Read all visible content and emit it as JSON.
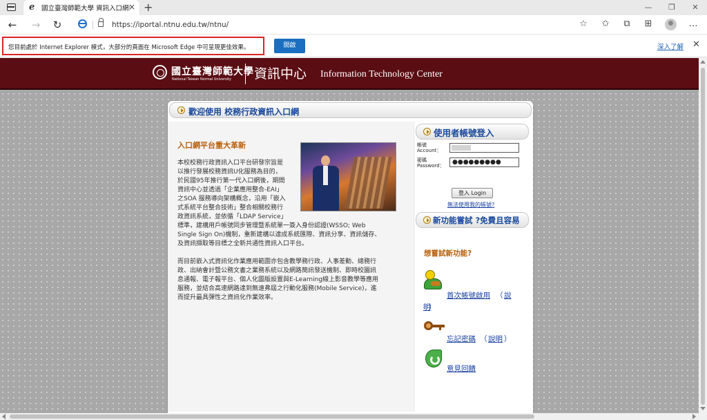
{
  "browser": {
    "tab_title": "國立臺灣師範大學 資訊入口網站",
    "tab_close": "×",
    "new_tab": "+",
    "window_buttons": [
      "—",
      "❐",
      "✕"
    ],
    "url": "https://iportal.ntnu.edu.tw/ntnu/",
    "nav": {
      "back": "←",
      "forward": "→",
      "reload": "↻"
    },
    "toolbar_icons": [
      "favorites-add-icon",
      "favorites-icon",
      "collections-icon",
      "extensions-icon",
      "profile-icon",
      "more-icon"
    ],
    "toolbar_glyphs": {
      "fav_add": "☆",
      "favorites": "✩",
      "collections": "⧉",
      "extensions": "⊞",
      "more": "…"
    }
  },
  "ie_bar": {
    "message": "您目前處於 Internet Explorer 模式，大部分的頁面在 Microsoft Edge 中可呈現更佳效果。",
    "open_button": "開啟",
    "learn_more": "深入了解",
    "close": "✕"
  },
  "banner": {
    "univ_cn": "國立臺灣師範大學",
    "univ_en": "National Taiwan Normal University",
    "center_cn": "資訊中心",
    "center_en": "Information Technology Center"
  },
  "welcome": "歡迎使用  校務行政資訊入口網",
  "news": {
    "title": "入口網平台重大革新",
    "body": "本校校務行政資訊入口平台研發宗旨是\n以推行發展校務資訊U化服務為目的，\n於民國95年推行第一代入口網後，期間\n資訊中心並透過「企業應用整合-EAI」\n之SOA 服務導向架構概念，沿用「嵌入\n式系統平台整合技術」整合相關校務行\n政資訊系統，並依循「LDAP Service」\n標準，建構用戶帳號同步管理暨系統單一簽入身份認證(WSSO; Web\nSingle Sign On)機制，重新建構以達成系統匯際、資訊分享、資訊儲存、\n及資訊擷取等目標之全新共通性資訊入口平台。\n\n而目前嵌入式資訊化作業應用範圍亦包含教學務行政、人事差勤、總務行\n政、出納會計暨公務文書之業務系統以及網路簡訊發送機制、即時校園訊\n息通報、電子報平台、個人化圖版設置與E-Learning線上影音教學等應用\n服務，並結合高速網路達到無遠弗屆之行動化服務(Mobile Service)，進\n而提升最具彈性之資訊化作業效率。"
  },
  "login": {
    "header": "使用者帳號登入",
    "account_label": "帳號\nAccount：",
    "password_label": "密碼\nPassword：",
    "password_value": "●●●●●●●●●",
    "button": "登入 Login",
    "cant_login": "無法使用我的帳號?"
  },
  "features": {
    "header": "新功能嘗試 ?免費且容易",
    "try_title": "想嘗試新功能?",
    "first_login_link": "首次帳號啟用",
    "first_login_open": "（",
    "first_login_help": "說",
    "first_login_help2": "明",
    "first_login_close": "）",
    "forgot_link": "忘記密碼",
    "forgot_help_open": "（",
    "forgot_help": "說明",
    "forgot_help_close": "）",
    "feedback_link": "意見回饋"
  }
}
